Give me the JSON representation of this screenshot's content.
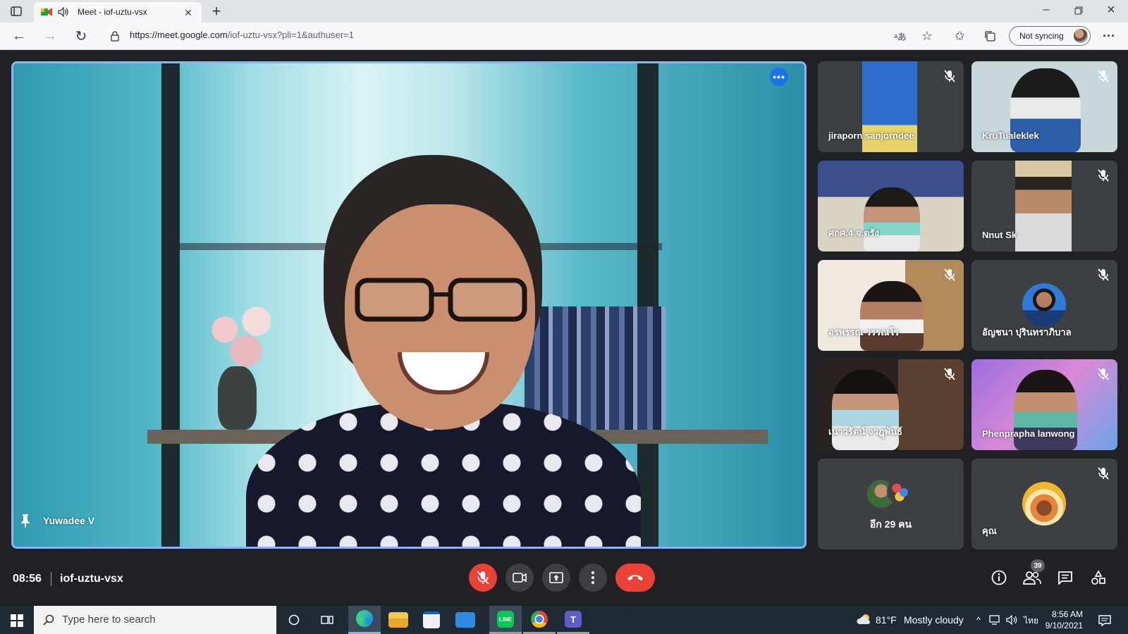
{
  "browser": {
    "tab_title": "Meet - iof-uztu-vsx",
    "url_domain": "https://meet.google.com",
    "url_path": "/iof-uztu-vsx?pli=1&authuser=1",
    "sync_label": "Not syncing"
  },
  "main_video": {
    "participant_name": "Yuwadee V"
  },
  "tiles": [
    {
      "name": "jiraporn sanjorndee",
      "muted": true
    },
    {
      "name": "KruTualeklek",
      "muted": true
    },
    {
      "name": "ศกศ.4 จ.ตรัง",
      "muted": false
    },
    {
      "name": "Nnut Sk",
      "muted": true
    },
    {
      "name": "อรพรรณ วรรณโร",
      "muted": true
    },
    {
      "name": "อัญชนา ปุรินทราภิบาล",
      "muted": true
    },
    {
      "name": "เนาวรัตน์ จาฎุพันธ์",
      "muted": true
    },
    {
      "name": "Phenprapha lanwong",
      "muted": true
    },
    {
      "name": "อีก 29 คน",
      "muted": false
    },
    {
      "name": "คุณ",
      "muted": true
    }
  ],
  "meeting": {
    "time": "08:56",
    "code": "iof-uztu-vsx",
    "participants_count": "39"
  },
  "taskbar": {
    "search_placeholder": "Type here to search",
    "weather_temp": "81°F",
    "weather_desc": "Mostly cloudy",
    "language": "ไทย",
    "clock_time": "8:56 AM",
    "clock_date": "9/10/2021"
  },
  "colors": {
    "accent_blue": "#8ab4f8",
    "end_call_red": "#ea4335",
    "meet_bg": "#202124",
    "tile_bg": "#3c4043"
  }
}
